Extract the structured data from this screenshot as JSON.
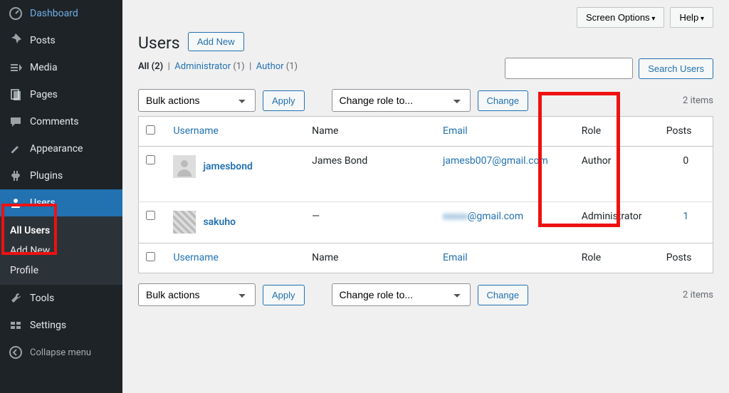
{
  "sidebar": {
    "dashboard": "Dashboard",
    "posts": "Posts",
    "media": "Media",
    "pages": "Pages",
    "comments": "Comments",
    "appearance": "Appearance",
    "plugins": "Plugins",
    "users": "Users",
    "tools": "Tools",
    "settings": "Settings",
    "collapse": "Collapse menu",
    "submenu": {
      "all_users": "All Users",
      "add_new": "Add New",
      "profile": "Profile"
    }
  },
  "topbar": {
    "screen_options": "Screen Options",
    "help": "Help"
  },
  "header": {
    "title": "Users",
    "add_new": "Add New"
  },
  "filters": {
    "all_label": "All",
    "all_count": "(2)",
    "admin_label": "Administrator",
    "admin_count": "(1)",
    "author_label": "Author",
    "author_count": "(1)"
  },
  "search": {
    "placeholder": "",
    "button": "Search Users"
  },
  "bulk": {
    "bulk_actions": "Bulk actions",
    "apply": "Apply",
    "change_role": "Change role to...",
    "change": "Change",
    "items": "2 items"
  },
  "columns": {
    "username": "Username",
    "name": "Name",
    "email": "Email",
    "role": "Role",
    "posts": "Posts"
  },
  "rows": [
    {
      "username": "jamesbond",
      "name": "James Bond",
      "email": "jamesb007@gmail.com",
      "email_obscured": "",
      "role": "Author",
      "posts": "0",
      "posts_link": false
    },
    {
      "username": "sakuho",
      "name": "—",
      "email": "@gmail.com",
      "email_obscured": "xxxxx",
      "role": "Administrator",
      "posts": "1",
      "posts_link": true
    }
  ]
}
